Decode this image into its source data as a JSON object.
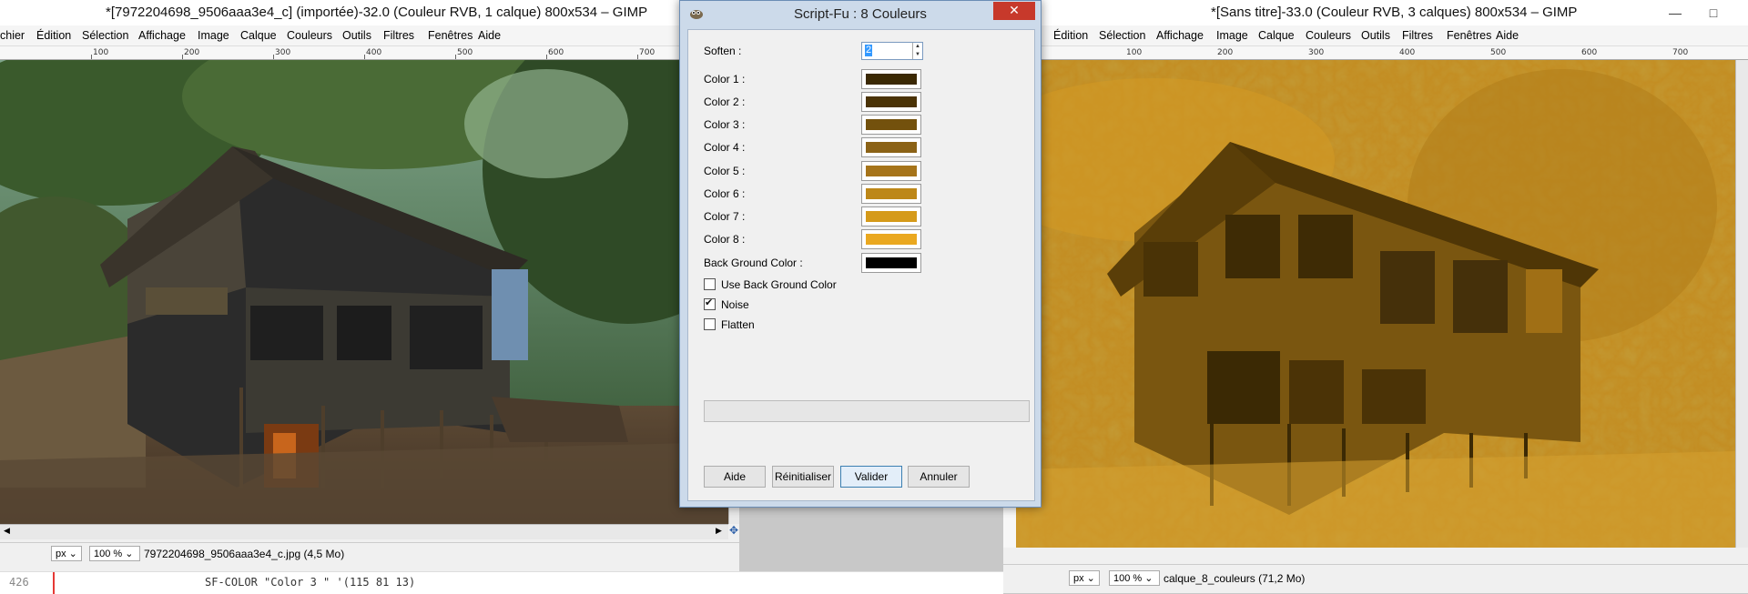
{
  "left_window": {
    "title": "*[7972204698_9506aaa3e4_c] (importée)-32.0 (Couleur RVB, 1 calque) 800x534 – GIMP",
    "menu": [
      "chier",
      "Édition",
      "Sélection",
      "Affichage",
      "Image",
      "Calque",
      "Couleurs",
      "Outils",
      "Filtres",
      "Fenêtres",
      "Aide"
    ],
    "ruler_ticks": [
      "100",
      "200",
      "300",
      "400",
      "500",
      "600",
      "700"
    ],
    "status": {
      "unit": "px",
      "zoom": "100 %",
      "info": "7972204698_9506aaa3e4_c.jpg (4,5 Mo)"
    }
  },
  "right_window": {
    "title": "*[Sans titre]-33.0 (Couleur RVB, 3 calques) 800x534 – GIMP",
    "menu": [
      "Édition",
      "Sélection",
      "Affichage",
      "Image",
      "Calque",
      "Couleurs",
      "Outils",
      "Filtres",
      "Fenêtres",
      "Aide"
    ],
    "ruler_ticks": [
      "100",
      "200",
      "300",
      "400",
      "500",
      "600",
      "700"
    ],
    "status": {
      "unit": "px",
      "zoom": "100 %",
      "info": "calque_8_couleurs (71,2 Mo)"
    },
    "controls": {
      "minimize": "—",
      "maximize": "□"
    }
  },
  "dialog": {
    "title": "Script-Fu : 8 Couleurs",
    "close": "✕",
    "soften": {
      "label": "Soften :",
      "value": "2"
    },
    "colors": [
      {
        "label": "Color 1 :",
        "hex": "#3b2904"
      },
      {
        "label": "Color 2 :",
        "hex": "#4b3306"
      },
      {
        "label": "Color 3 :",
        "hex": "#73510d"
      },
      {
        "label": "Color 4 :",
        "hex": "#8b6216"
      },
      {
        "label": "Color 5 :",
        "hex": "#a6741a"
      },
      {
        "label": "Color 6 :",
        "hex": "#bd8717"
      },
      {
        "label": "Color 7 :",
        "hex": "#d59a1a"
      },
      {
        "label": "Color 8 :",
        "hex": "#eaa820"
      },
      {
        "label": "Back Ground Color :",
        "hex": "#000000"
      }
    ],
    "checkboxes": [
      {
        "label": "Use Back Ground Color",
        "checked": false
      },
      {
        "label": "Noise",
        "checked": true
      },
      {
        "label": "Flatten",
        "checked": false
      }
    ],
    "buttons": {
      "help": "Aide",
      "reset": "Réinitialiser",
      "ok": "Valider",
      "cancel": "Annuler"
    }
  },
  "code_line": {
    "number": "426",
    "text": "SF-COLOR \"Color 3 \" '(115 81 13)"
  }
}
